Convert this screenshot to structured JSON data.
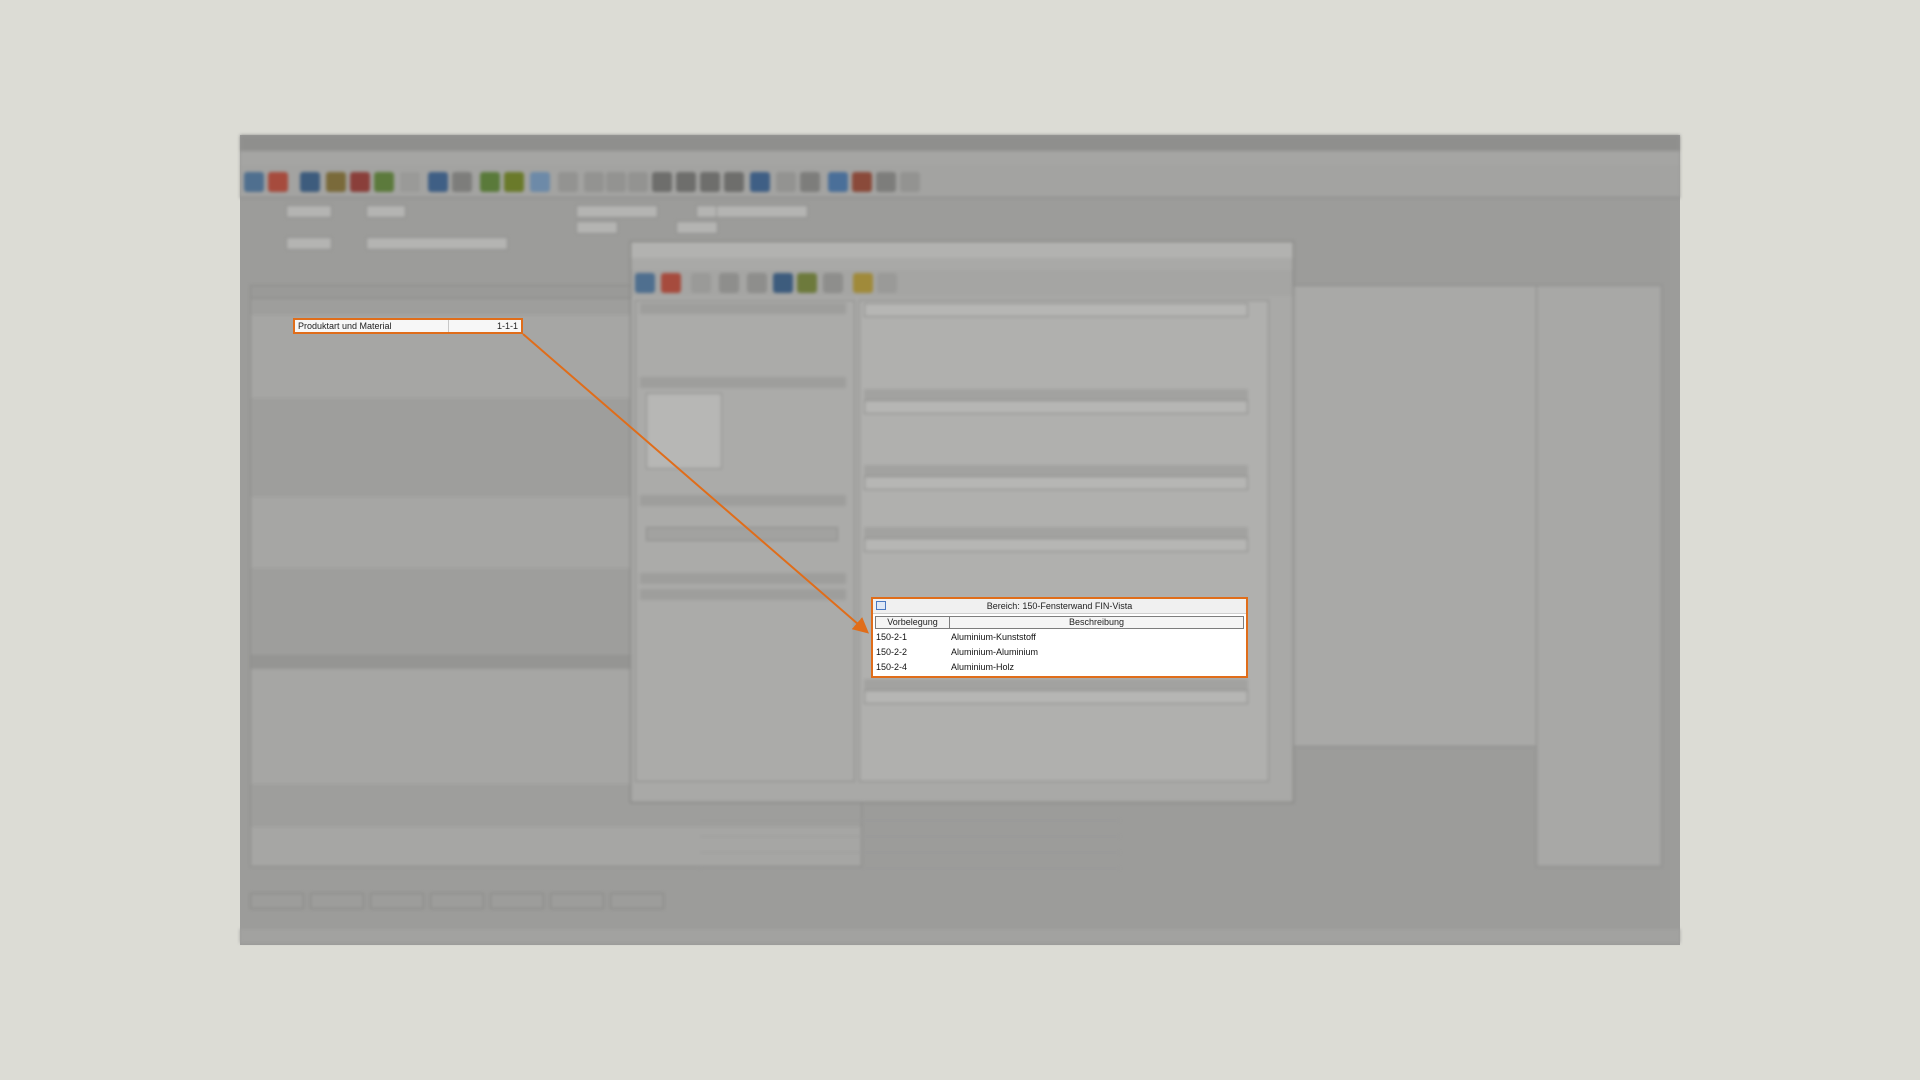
{
  "highlight_top": {
    "label": "Produktart und Material",
    "value": "1-1-1"
  },
  "highlight_table": {
    "title": "Bereich: 150-Fensterwand FIN-Vista",
    "columns": [
      "Vorbelegung",
      "Beschreibung"
    ],
    "rows": [
      {
        "code": "150-2-1",
        "desc": "Aluminium-Kunststoff"
      },
      {
        "code": "150-2-2",
        "desc": "Aluminium-Aluminium"
      },
      {
        "code": "150-2-4",
        "desc": "Aluminium-Holz"
      }
    ]
  },
  "colors": {
    "accent": "#e06d1a",
    "backdrop": "#dcdcd5"
  }
}
